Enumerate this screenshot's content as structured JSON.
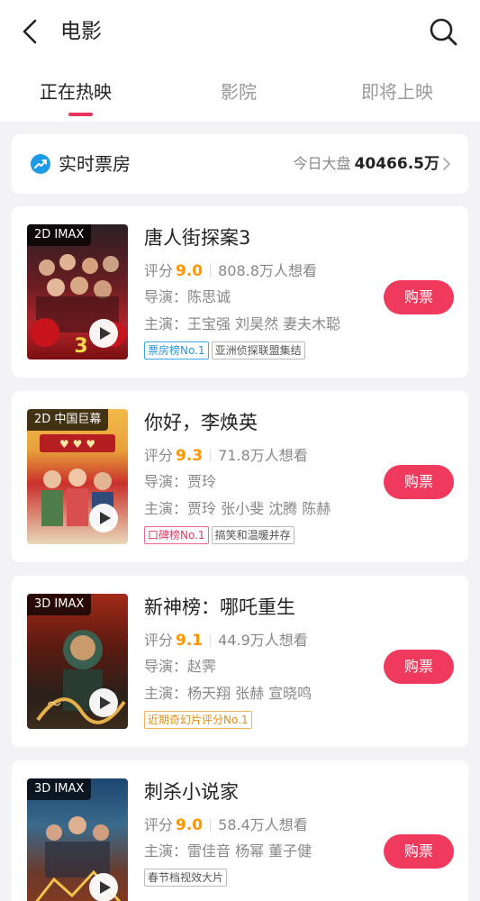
{
  "header": {
    "title": "电影",
    "tabs": [
      {
        "label": "正在热映",
        "active": true
      },
      {
        "label": "影院",
        "active": false
      },
      {
        "label": "即将上映",
        "active": false
      }
    ]
  },
  "boxoffice": {
    "label": "实时票房",
    "caption": "今日大盘",
    "value": "40466.5万"
  },
  "movies": [
    {
      "format": "2D IMAX",
      "title": "唐人街探案3",
      "rating_label": "评分",
      "rating": "9.0",
      "want": "808.8万人想看",
      "director": "导演：陈思诚",
      "cast": "主演：王宝强 刘昊然 妻夫木聪",
      "tags": [
        "票房榜No.1",
        "亚洲侦探联盟集结"
      ],
      "buy_label": "购票"
    },
    {
      "format": "2D 中国巨幕",
      "title": "你好，李焕英",
      "rating_label": "评分",
      "rating": "9.3",
      "want": "71.8万人想看",
      "director": "导演：贾玲",
      "cast": "主演：贾玲 张小斐 沈腾 陈赫",
      "tags": [
        "口碑榜No.1",
        "搞笑和温暖并存"
      ],
      "buy_label": "购票"
    },
    {
      "format": "3D IMAX",
      "title": "新神榜：哪吒重生",
      "rating_label": "评分",
      "rating": "9.1",
      "want": "44.9万人想看",
      "director": "导演：赵霁",
      "cast": "主演：杨天翔 张赫 宣晓鸣",
      "tags": [
        "近期奇幻片评分No.1"
      ],
      "buy_label": "购票"
    },
    {
      "format": "3D IMAX",
      "title": "刺杀小说家",
      "rating_label": "评分",
      "rating": "9.0",
      "want": "58.4万人想看",
      "cast": "主演：雷佳音 杨幂 董子健",
      "tags": [
        "春节档视效大片"
      ],
      "buy_label": "购票"
    }
  ],
  "colors": {
    "accent": "#f03a5d",
    "rating": "#ff9600",
    "tag_blue": "#2b97dc",
    "tag_pink": "#e03b63",
    "tag_orange": "#e58e13"
  },
  "icons": [
    "back-arrow-icon",
    "search-icon",
    "boxoffice-icon",
    "chevron-right-icon",
    "play-icon"
  ]
}
